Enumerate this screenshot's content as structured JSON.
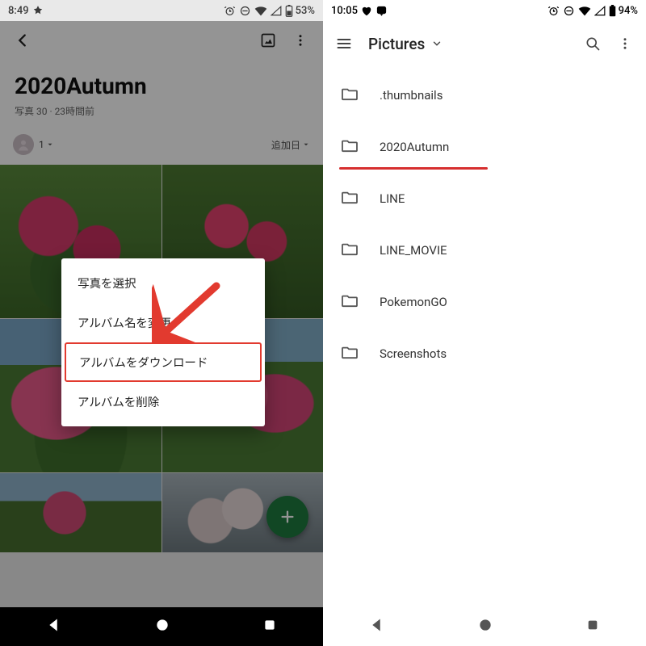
{
  "left": {
    "status": {
      "time": "8:49",
      "battery": "53%"
    },
    "album": {
      "title": "2020Autumn",
      "photo_count_label": "写真 30",
      "time_label": "23時間前",
      "people_count": "1",
      "sort_label": "追加日"
    },
    "menu": {
      "select_photos": "写真を選択",
      "rename_album": "アルバム名を変更",
      "download_album": "アルバムをダウンロード",
      "delete_album": "アルバムを削除"
    }
  },
  "right": {
    "status": {
      "time": "10:05",
      "battery": "94%"
    },
    "title": "Pictures",
    "folders": [
      ".thumbnails",
      "2020Autumn",
      "LINE",
      "LINE_MOVIE",
      "PokemonGO",
      "Screenshots"
    ]
  }
}
